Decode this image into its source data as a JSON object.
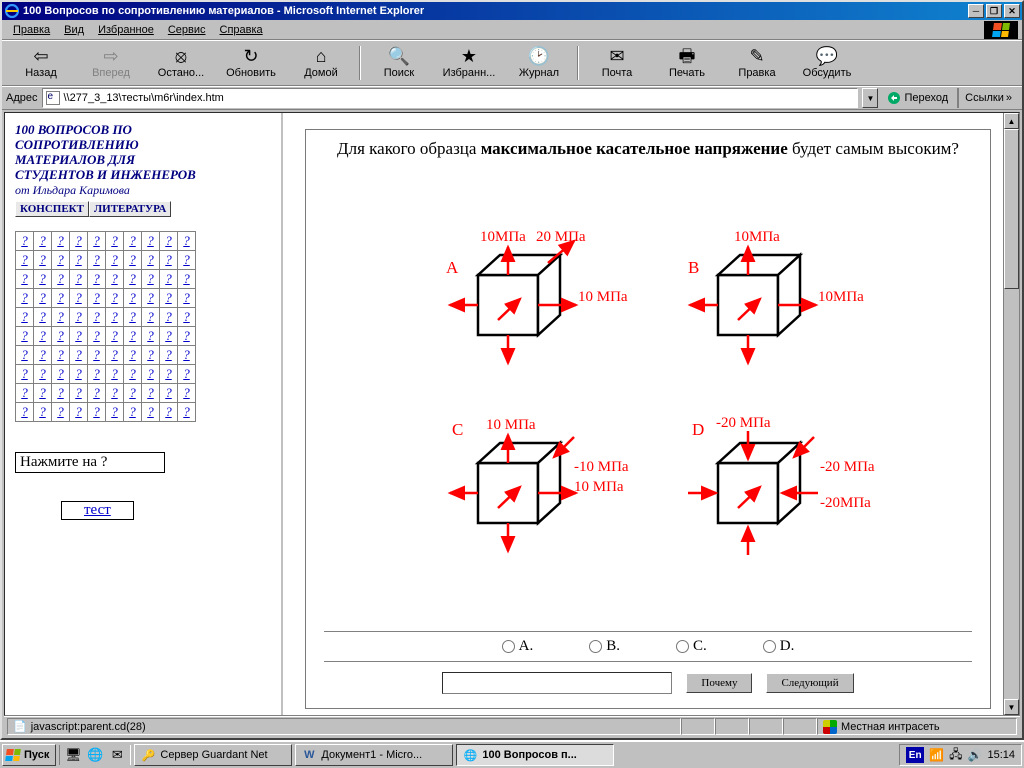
{
  "titlebar": {
    "title": "100 Вопросов по сопротивлению материалов - Microsoft Internet Explorer"
  },
  "menu": {
    "edit": "Правка",
    "view": "Вид",
    "fav": "Избранное",
    "tools": "Сервис",
    "help": "Справка"
  },
  "tool": {
    "back": "Назад",
    "forward": "Вперед",
    "stop": "Остано...",
    "refresh": "Обновить",
    "home": "Домой",
    "search": "Поиск",
    "favorites": "Избранн...",
    "history": "Журнал",
    "mail": "Почта",
    "print": "Печать",
    "edit": "Правка",
    "discuss": "Обсудить"
  },
  "addr": {
    "label": "Адрес",
    "value": "\\\\277_3_13\\тесты\\m6r\\index.htm",
    "go": "Переход",
    "links": "Ссылки"
  },
  "left": {
    "l1": "100 ВОПРОСОВ ПО",
    "l2": "СОПРОТИВЛЕНИЮ",
    "l3": "МАТЕРИАЛОВ ДЛЯ",
    "l4": "СТУДЕНТОВ И ИНЖЕНЕРОВ",
    "author": "от Ильдара Каримова",
    "btn_conspect": "КОНСПЕКТ",
    "btn_lit": "ЛИТЕРАТУРА",
    "cell": "?",
    "hint": "Нажмите на   ?",
    "test": "тест"
  },
  "question": {
    "pre": "Для какого образца ",
    "bold": "максимальное касательное напряжение",
    "post": " будет самым высоким?"
  },
  "diagram": {
    "A": {
      "key": "A",
      "top": "10МПа",
      "diag": "20 МПа",
      "right": "10 МПа"
    },
    "B": {
      "key": "B",
      "top": "10МПа",
      "right": "10МПа"
    },
    "C": {
      "key": "C",
      "top": "10 МПа",
      "r1": "-10 МПа",
      "r2": "10 МПа"
    },
    "D": {
      "key": "D",
      "top": "-20 МПа",
      "r1": "-20 МПа",
      "r2": "-20МПа"
    }
  },
  "answers": {
    "a": "A.",
    "b": "B.",
    "c": "C.",
    "d": "D."
  },
  "buttons": {
    "why": "Почему",
    "next": "Следующий"
  },
  "status": {
    "text": "javascript:parent.cd(28)",
    "zone": "Местная интрасеть"
  },
  "taskbar": {
    "start": "Пуск",
    "t1": "Сервер Guardant Net",
    "t2": "Документ1 - Micro...",
    "t3": "100 Вопросов п...",
    "lang": "En",
    "clock": "15:14"
  }
}
